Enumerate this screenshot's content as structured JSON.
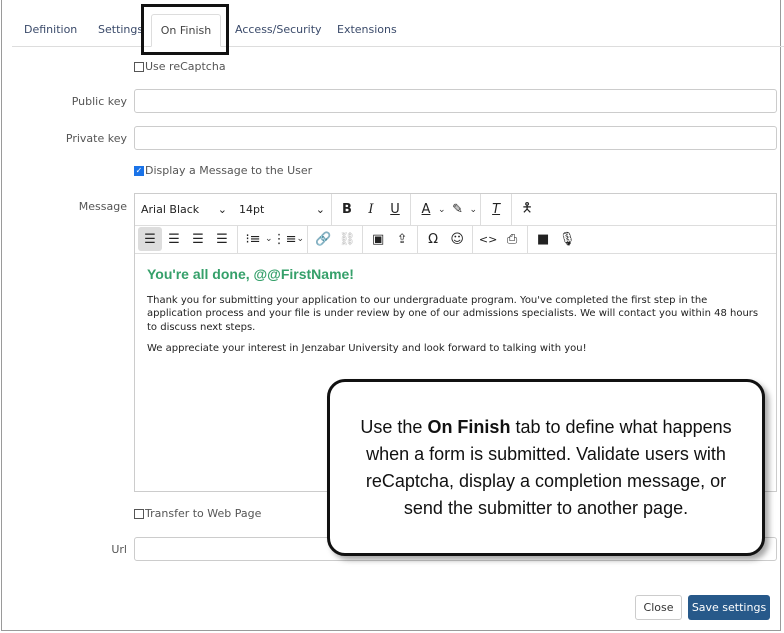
{
  "tabs": [
    "Definition",
    "Settings",
    "On Finish",
    "Access/Security",
    "Extensions"
  ],
  "form": {
    "recaptcha_label": "Use reCaptcha",
    "public_key_label": "Public key",
    "public_key_value": "",
    "private_key_label": "Private key",
    "private_key_value": "",
    "display_message_label": "Display a Message to the User",
    "message_label": "Message",
    "transfer_label": "Transfer to Web Page",
    "url_label": "Url",
    "url_value": ""
  },
  "editor": {
    "font": "Arial Black",
    "size": "14pt",
    "heading": "You're all done, @@FirstName!",
    "para1": "Thank you for submitting your application to our undergraduate program. You've completed the first step in the application process and your file is under review by one of our admissions specialists. We will contact you within 48 hours to discuss next steps.",
    "para2": "We appreciate your interest in Jenzabar University and look forward to talking with you!",
    "heading_color": "#35a06a"
  },
  "callout": {
    "before": "Use the ",
    "bold": "On Finish",
    "after": " tab to define what happens when a form is submitted. Validate users with reCaptcha, display a completion message, or send the submitter to another page."
  },
  "buttons": {
    "close": "Close",
    "save": "Save settings"
  }
}
